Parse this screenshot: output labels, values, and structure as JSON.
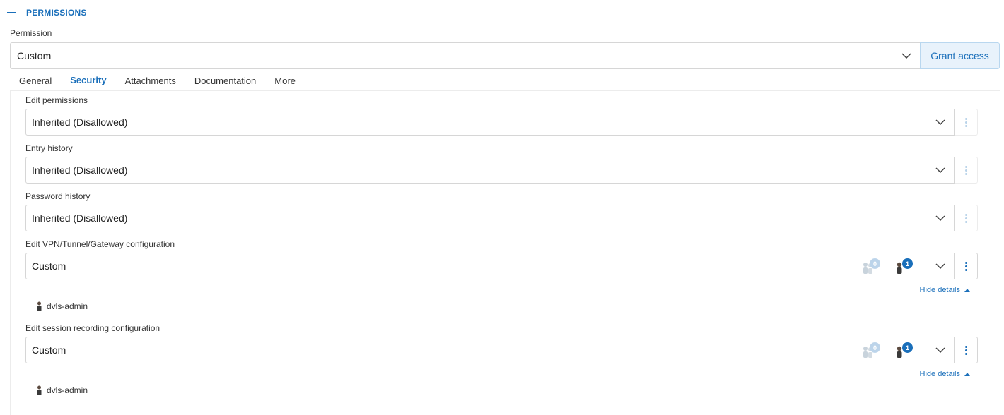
{
  "section": {
    "title": "PERMISSIONS"
  },
  "permission": {
    "label": "Permission",
    "value": "Custom",
    "grant_label": "Grant access"
  },
  "tabs": [
    {
      "label": "General",
      "active": false
    },
    {
      "label": "Security",
      "active": true
    },
    {
      "label": "Attachments",
      "active": false
    },
    {
      "label": "Documentation",
      "active": false
    },
    {
      "label": "More",
      "active": false
    }
  ],
  "fields": [
    {
      "label": "Edit permissions",
      "value": "Inherited (Disallowed)"
    },
    {
      "label": "Entry history",
      "value": "Inherited (Disallowed)"
    },
    {
      "label": "Password history",
      "value": "Inherited (Disallowed)"
    },
    {
      "label": "Edit VPN/Tunnel/Gateway configuration",
      "value": "Custom",
      "group_count": "0",
      "user_count": "1",
      "hide_details": "Hide details",
      "user": "dvls-admin"
    },
    {
      "label": "Edit session recording configuration",
      "value": "Custom",
      "group_count": "0",
      "user_count": "1",
      "hide_details": "Hide details",
      "user": "dvls-admin"
    }
  ],
  "colors": {
    "accent": "#1a6fba",
    "accent_light": "#e8f2fb",
    "border": "#d6d6d6"
  },
  "icons": {
    "collapse": "minus-icon",
    "dropdown": "chevron-down-icon",
    "menu": "kebab-menu-icon",
    "group": "users-group-icon",
    "user": "user-icon",
    "expand": "triangle-up-icon"
  }
}
